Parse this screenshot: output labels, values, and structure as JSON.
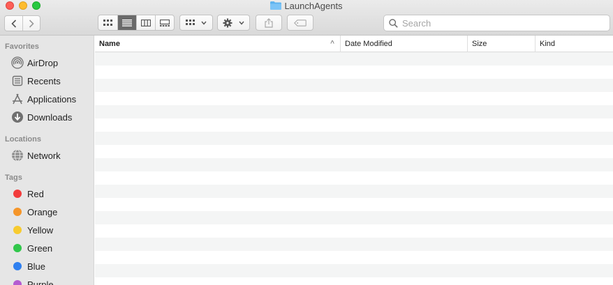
{
  "window": {
    "title": "LaunchAgents"
  },
  "toolbar": {
    "back_icon": "chevron-left-icon",
    "forward_icon": "chevron-right-icon",
    "views": [
      "icon-view",
      "list-view",
      "column-view",
      "gallery-view"
    ],
    "active_view": "list-view",
    "search": {
      "placeholder": "Search",
      "value": ""
    }
  },
  "sidebar": {
    "favorites_label": "Favorites",
    "favorites": [
      {
        "label": "AirDrop",
        "icon": "airdrop-icon"
      },
      {
        "label": "Recents",
        "icon": "recents-icon"
      },
      {
        "label": "Applications",
        "icon": "applications-icon"
      },
      {
        "label": "Downloads",
        "icon": "downloads-icon"
      }
    ],
    "locations_label": "Locations",
    "locations": [
      {
        "label": "Network",
        "icon": "network-icon"
      }
    ],
    "tags_label": "Tags",
    "tags": [
      {
        "label": "Red",
        "color": "#f23c3c"
      },
      {
        "label": "Orange",
        "color": "#f5962a"
      },
      {
        "label": "Yellow",
        "color": "#f7cb2f"
      },
      {
        "label": "Green",
        "color": "#31c74b"
      },
      {
        "label": "Blue",
        "color": "#2f80f0"
      },
      {
        "label": "Purple",
        "color": "#b55bd1"
      }
    ]
  },
  "list": {
    "columns": {
      "name": "Name",
      "date_modified": "Date Modified",
      "size": "Size",
      "kind": "Kind"
    },
    "sort_indicator": "^"
  }
}
